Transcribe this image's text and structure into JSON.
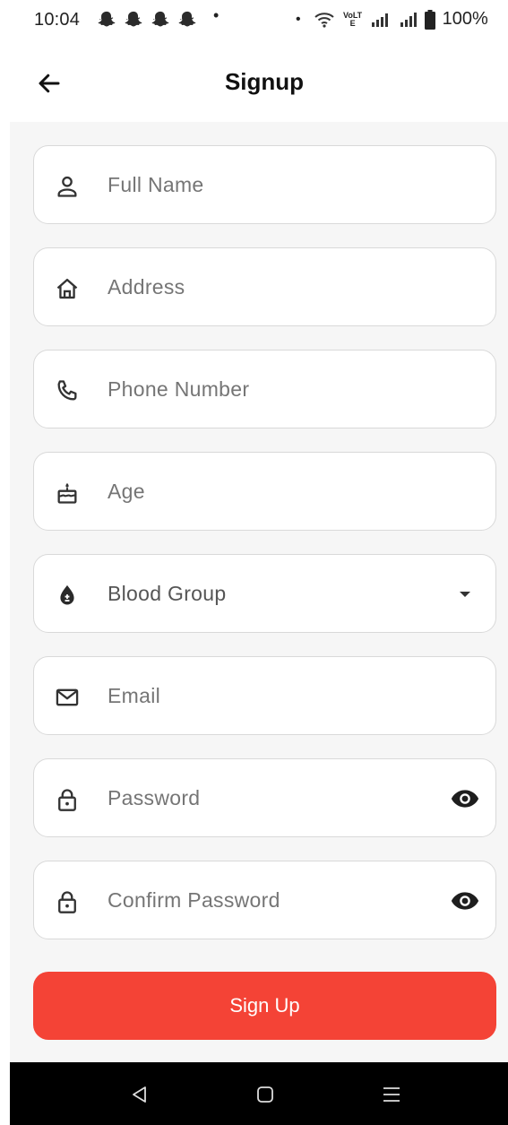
{
  "status_bar": {
    "time": "10:04",
    "battery_text": "100%",
    "network_label": "VoLTE",
    "icons": [
      "snapchat-icon",
      "snapchat-icon",
      "snapchat-icon",
      "snapchat-icon",
      "wifi-icon",
      "signal-icon",
      "signal-icon",
      "battery-icon"
    ]
  },
  "app_bar": {
    "title": "Signup",
    "back_icon": "arrow-left-icon"
  },
  "form": {
    "full_name": {
      "placeholder": "Full Name",
      "icon": "person-icon"
    },
    "address": {
      "placeholder": "Address",
      "icon": "home-icon"
    },
    "phone": {
      "placeholder": "Phone Number",
      "icon": "phone-icon"
    },
    "age": {
      "placeholder": "Age",
      "icon": "cake-icon"
    },
    "blood_group": {
      "placeholder": "Blood Group",
      "icon": "blood-drop-icon",
      "trailing_icon": "dropdown-arrow-icon"
    },
    "email": {
      "placeholder": "Email",
      "icon": "mail-icon"
    },
    "password": {
      "placeholder": "Password",
      "icon": "lock-icon",
      "trailing_icon": "eye-icon"
    },
    "confirm_password": {
      "placeholder": "Confirm Password",
      "icon": "lock-icon",
      "trailing_icon": "eye-icon"
    }
  },
  "signup_button": {
    "label": "Sign Up"
  },
  "colors": {
    "accent": "#f44336",
    "form_background": "#f6f6f6",
    "field_border": "#d9d9d9",
    "nav_bar": "#000000"
  },
  "nav_bar": {
    "icons": [
      "back-triangle-icon",
      "home-square-icon",
      "recents-menu-icon"
    ]
  }
}
